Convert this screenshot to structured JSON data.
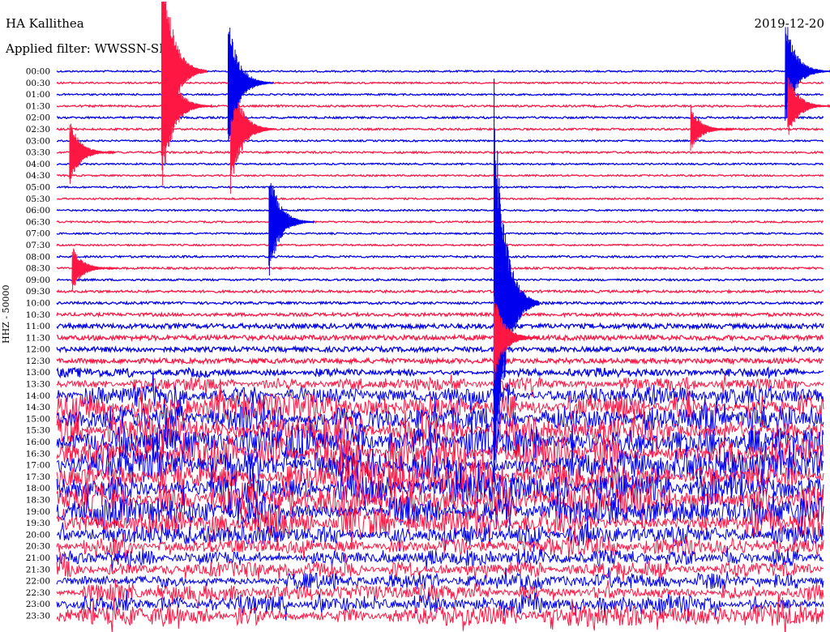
{
  "header": {
    "station": "HA Kallithea",
    "filter": "Applied filter: WWSSN-SP",
    "date": "2019-12-20",
    "channel_label": "HHZ - 50000"
  },
  "colors": {
    "trace_a": "#0000ee",
    "trace_b": "#ff1744"
  },
  "chart_data": {
    "type": "line",
    "title": "HA Kallithea",
    "subtitle": "Applied filter: WWSSN-SP",
    "date": "2019-12-20",
    "ylabel": "HHZ - 50000",
    "xlabel": "",
    "grid": false,
    "legend": "none",
    "x_range_minutes": [
      0,
      30
    ],
    "rows": [
      {
        "time": "00:00",
        "color": "blue",
        "amplitude": 1.0
      },
      {
        "time": "00:30",
        "color": "red",
        "amplitude": 1.0
      },
      {
        "time": "01:00",
        "color": "blue",
        "amplitude": 1.0
      },
      {
        "time": "01:30",
        "color": "red",
        "amplitude": 1.2
      },
      {
        "time": "02:00",
        "color": "blue",
        "amplitude": 1.2
      },
      {
        "time": "02:30",
        "color": "red",
        "amplitude": 1.2
      },
      {
        "time": "03:00",
        "color": "blue",
        "amplitude": 1.0
      },
      {
        "time": "03:30",
        "color": "red",
        "amplitude": 1.2
      },
      {
        "time": "04:00",
        "color": "blue",
        "amplitude": 1.0
      },
      {
        "time": "04:30",
        "color": "red",
        "amplitude": 1.0
      },
      {
        "time": "05:00",
        "color": "blue",
        "amplitude": 1.0
      },
      {
        "time": "05:30",
        "color": "red",
        "amplitude": 1.0
      },
      {
        "time": "06:00",
        "color": "blue",
        "amplitude": 1.0
      },
      {
        "time": "06:30",
        "color": "red",
        "amplitude": 1.0
      },
      {
        "time": "07:00",
        "color": "blue",
        "amplitude": 1.0
      },
      {
        "time": "07:30",
        "color": "red",
        "amplitude": 1.0
      },
      {
        "time": "08:00",
        "color": "blue",
        "amplitude": 1.2
      },
      {
        "time": "08:30",
        "color": "red",
        "amplitude": 1.2
      },
      {
        "time": "09:00",
        "color": "blue",
        "amplitude": 1.2
      },
      {
        "time": "09:30",
        "color": "red",
        "amplitude": 1.5
      },
      {
        "time": "10:00",
        "color": "blue",
        "amplitude": 1.5
      },
      {
        "time": "10:30",
        "color": "red",
        "amplitude": 2.0
      },
      {
        "time": "11:00",
        "color": "blue",
        "amplitude": 3.0
      },
      {
        "time": "11:30",
        "color": "red",
        "amplitude": 3.0
      },
      {
        "time": "12:00",
        "color": "blue",
        "amplitude": 3.0
      },
      {
        "time": "12:30",
        "color": "red",
        "amplitude": 3.0
      },
      {
        "time": "13:00",
        "color": "blue",
        "amplitude": 4.0
      },
      {
        "time": "13:30",
        "color": "red",
        "amplitude": 6.0
      },
      {
        "time": "14:00",
        "color": "blue",
        "amplitude": 9.0
      },
      {
        "time": "14:30",
        "color": "red",
        "amplitude": 11.0
      },
      {
        "time": "15:00",
        "color": "blue",
        "amplitude": 12.0
      },
      {
        "time": "15:30",
        "color": "red",
        "amplitude": 13.0
      },
      {
        "time": "16:00",
        "color": "blue",
        "amplitude": 14.0
      },
      {
        "time": "16:30",
        "color": "red",
        "amplitude": 15.0
      },
      {
        "time": "17:00",
        "color": "blue",
        "amplitude": 14.0
      },
      {
        "time": "17:30",
        "color": "red",
        "amplitude": 14.0
      },
      {
        "time": "18:00",
        "color": "blue",
        "amplitude": 14.0
      },
      {
        "time": "18:30",
        "color": "red",
        "amplitude": 14.0
      },
      {
        "time": "19:00",
        "color": "blue",
        "amplitude": 13.0
      },
      {
        "time": "19:30",
        "color": "red",
        "amplitude": 12.0
      },
      {
        "time": "20:00",
        "color": "blue",
        "amplitude": 9.0
      },
      {
        "time": "20:30",
        "color": "red",
        "amplitude": 8.0
      },
      {
        "time": "21:00",
        "color": "blue",
        "amplitude": 7.0
      },
      {
        "time": "21:30",
        "color": "red",
        "amplitude": 7.0
      },
      {
        "time": "22:00",
        "color": "blue",
        "amplitude": 7.0
      },
      {
        "time": "22:30",
        "color": "red",
        "amplitude": 7.0
      },
      {
        "time": "23:00",
        "color": "blue",
        "amplitude": 8.0
      },
      {
        "time": "23:30",
        "color": "red",
        "amplitude": 9.0
      }
    ],
    "events": [
      {
        "row": "00:00",
        "minute": 4.1,
        "amplitude": 12,
        "color": "red"
      },
      {
        "row": "01:30",
        "minute": 4.3,
        "amplitude": 5,
        "color": "red"
      },
      {
        "row": "02:30",
        "minute": 6.8,
        "amplitude": 6,
        "color": "red"
      },
      {
        "row": "00:30",
        "minute": 6.7,
        "amplitude": 6,
        "color": "blue"
      },
      {
        "row": "03:30",
        "minute": 0.5,
        "amplitude": 3,
        "color": "red"
      },
      {
        "row": "06:30",
        "minute": 8.3,
        "amplitude": 5,
        "color": "blue"
      },
      {
        "row": "08:30",
        "minute": 0.6,
        "amplitude": 2,
        "color": "red"
      },
      {
        "row": "10:00",
        "minute": 17.1,
        "amplitude": 20,
        "color": "blue"
      },
      {
        "row": "11:30",
        "minute": 17.1,
        "amplitude": 4,
        "color": "red"
      },
      {
        "row": "00:00",
        "minute": 28.5,
        "amplitude": 5,
        "color": "blue"
      },
      {
        "row": "01:30",
        "minute": 28.6,
        "amplitude": 3,
        "color": "red"
      },
      {
        "row": "02:30",
        "minute": 24.8,
        "amplitude": 2,
        "color": "red"
      }
    ]
  }
}
